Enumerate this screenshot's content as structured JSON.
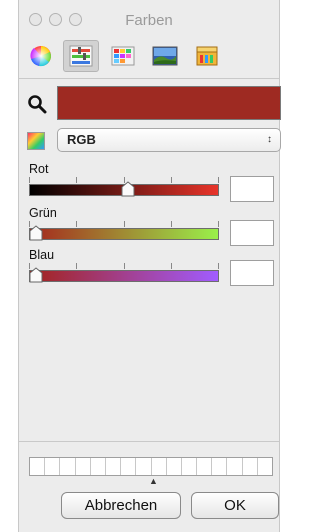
{
  "window": {
    "title": "Farben"
  },
  "toolbar": {
    "tabs": [
      {
        "name": "color-wheel",
        "active": false
      },
      {
        "name": "color-sliders",
        "active": true
      },
      {
        "name": "color-palettes",
        "active": false
      },
      {
        "name": "image-palettes",
        "active": false
      },
      {
        "name": "crayons",
        "active": false
      }
    ]
  },
  "picker": {
    "search_icon": "magnifier-icon",
    "current_color": "#9e2a22",
    "mode": "RGB"
  },
  "sliders": [
    {
      "label": "Rot",
      "value": 0.52,
      "gradient": [
        "#000000",
        "#e8342a"
      ],
      "value_text": ""
    },
    {
      "label": "Grün",
      "value": 0.0,
      "gradient": [
        "#a5271d",
        "#9af04a"
      ],
      "value_text": ""
    },
    {
      "label": "Blau",
      "value": 0.0,
      "gradient": [
        "#a3231c",
        "#a15cff"
      ],
      "value_text": ""
    }
  ],
  "buttons": {
    "cancel": "Abbrechen",
    "ok": "OK"
  }
}
